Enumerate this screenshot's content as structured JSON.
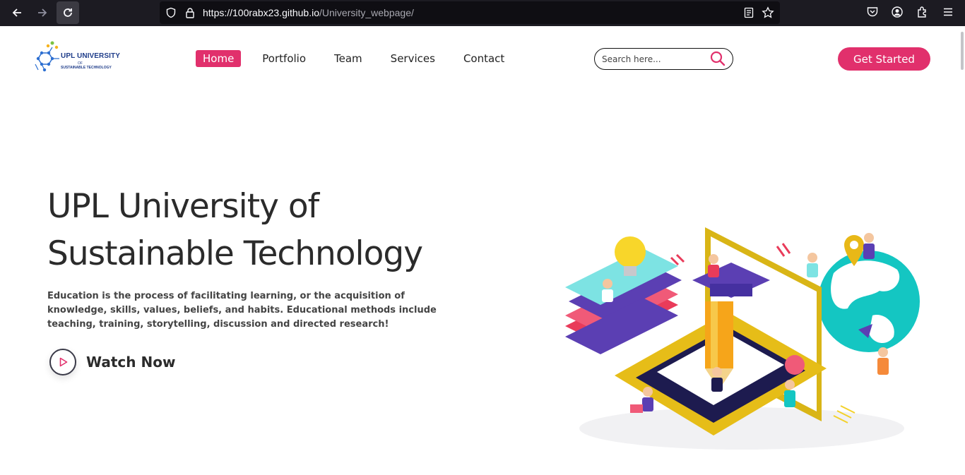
{
  "browser": {
    "url_host": "https://100rabx23.github.io",
    "url_path": "/University_webpage/"
  },
  "logo": {
    "line1": "UPL UNIVERSITY",
    "line2": "OF",
    "line3": "SUSTAINABLE TECHNOLOGY"
  },
  "nav": {
    "items": [
      "Home",
      "Portfolio",
      "Team",
      "Services",
      "Contact"
    ]
  },
  "search": {
    "placeholder": "Search here..."
  },
  "cta": {
    "label": "Get Started"
  },
  "hero": {
    "title_line1": "UPL University of",
    "title_line2": "Sustainable Technology",
    "description": "Education is the process of facilitating learning, or the acquisition of knowledge, skills, values, beliefs, and habits. Educational methods include teaching, training, storytelling, discussion and directed research!",
    "watch_label": "Watch Now"
  },
  "colors": {
    "accent": "#e1306c",
    "browser_bg": "#1c1b22"
  },
  "icons": [
    "back-arrow-icon",
    "forward-arrow-icon",
    "reload-icon",
    "shield-icon",
    "lock-icon",
    "reader-icon",
    "star-icon",
    "pocket-icon",
    "account-icon",
    "extensions-icon",
    "menu-icon",
    "search-icon",
    "play-icon"
  ]
}
